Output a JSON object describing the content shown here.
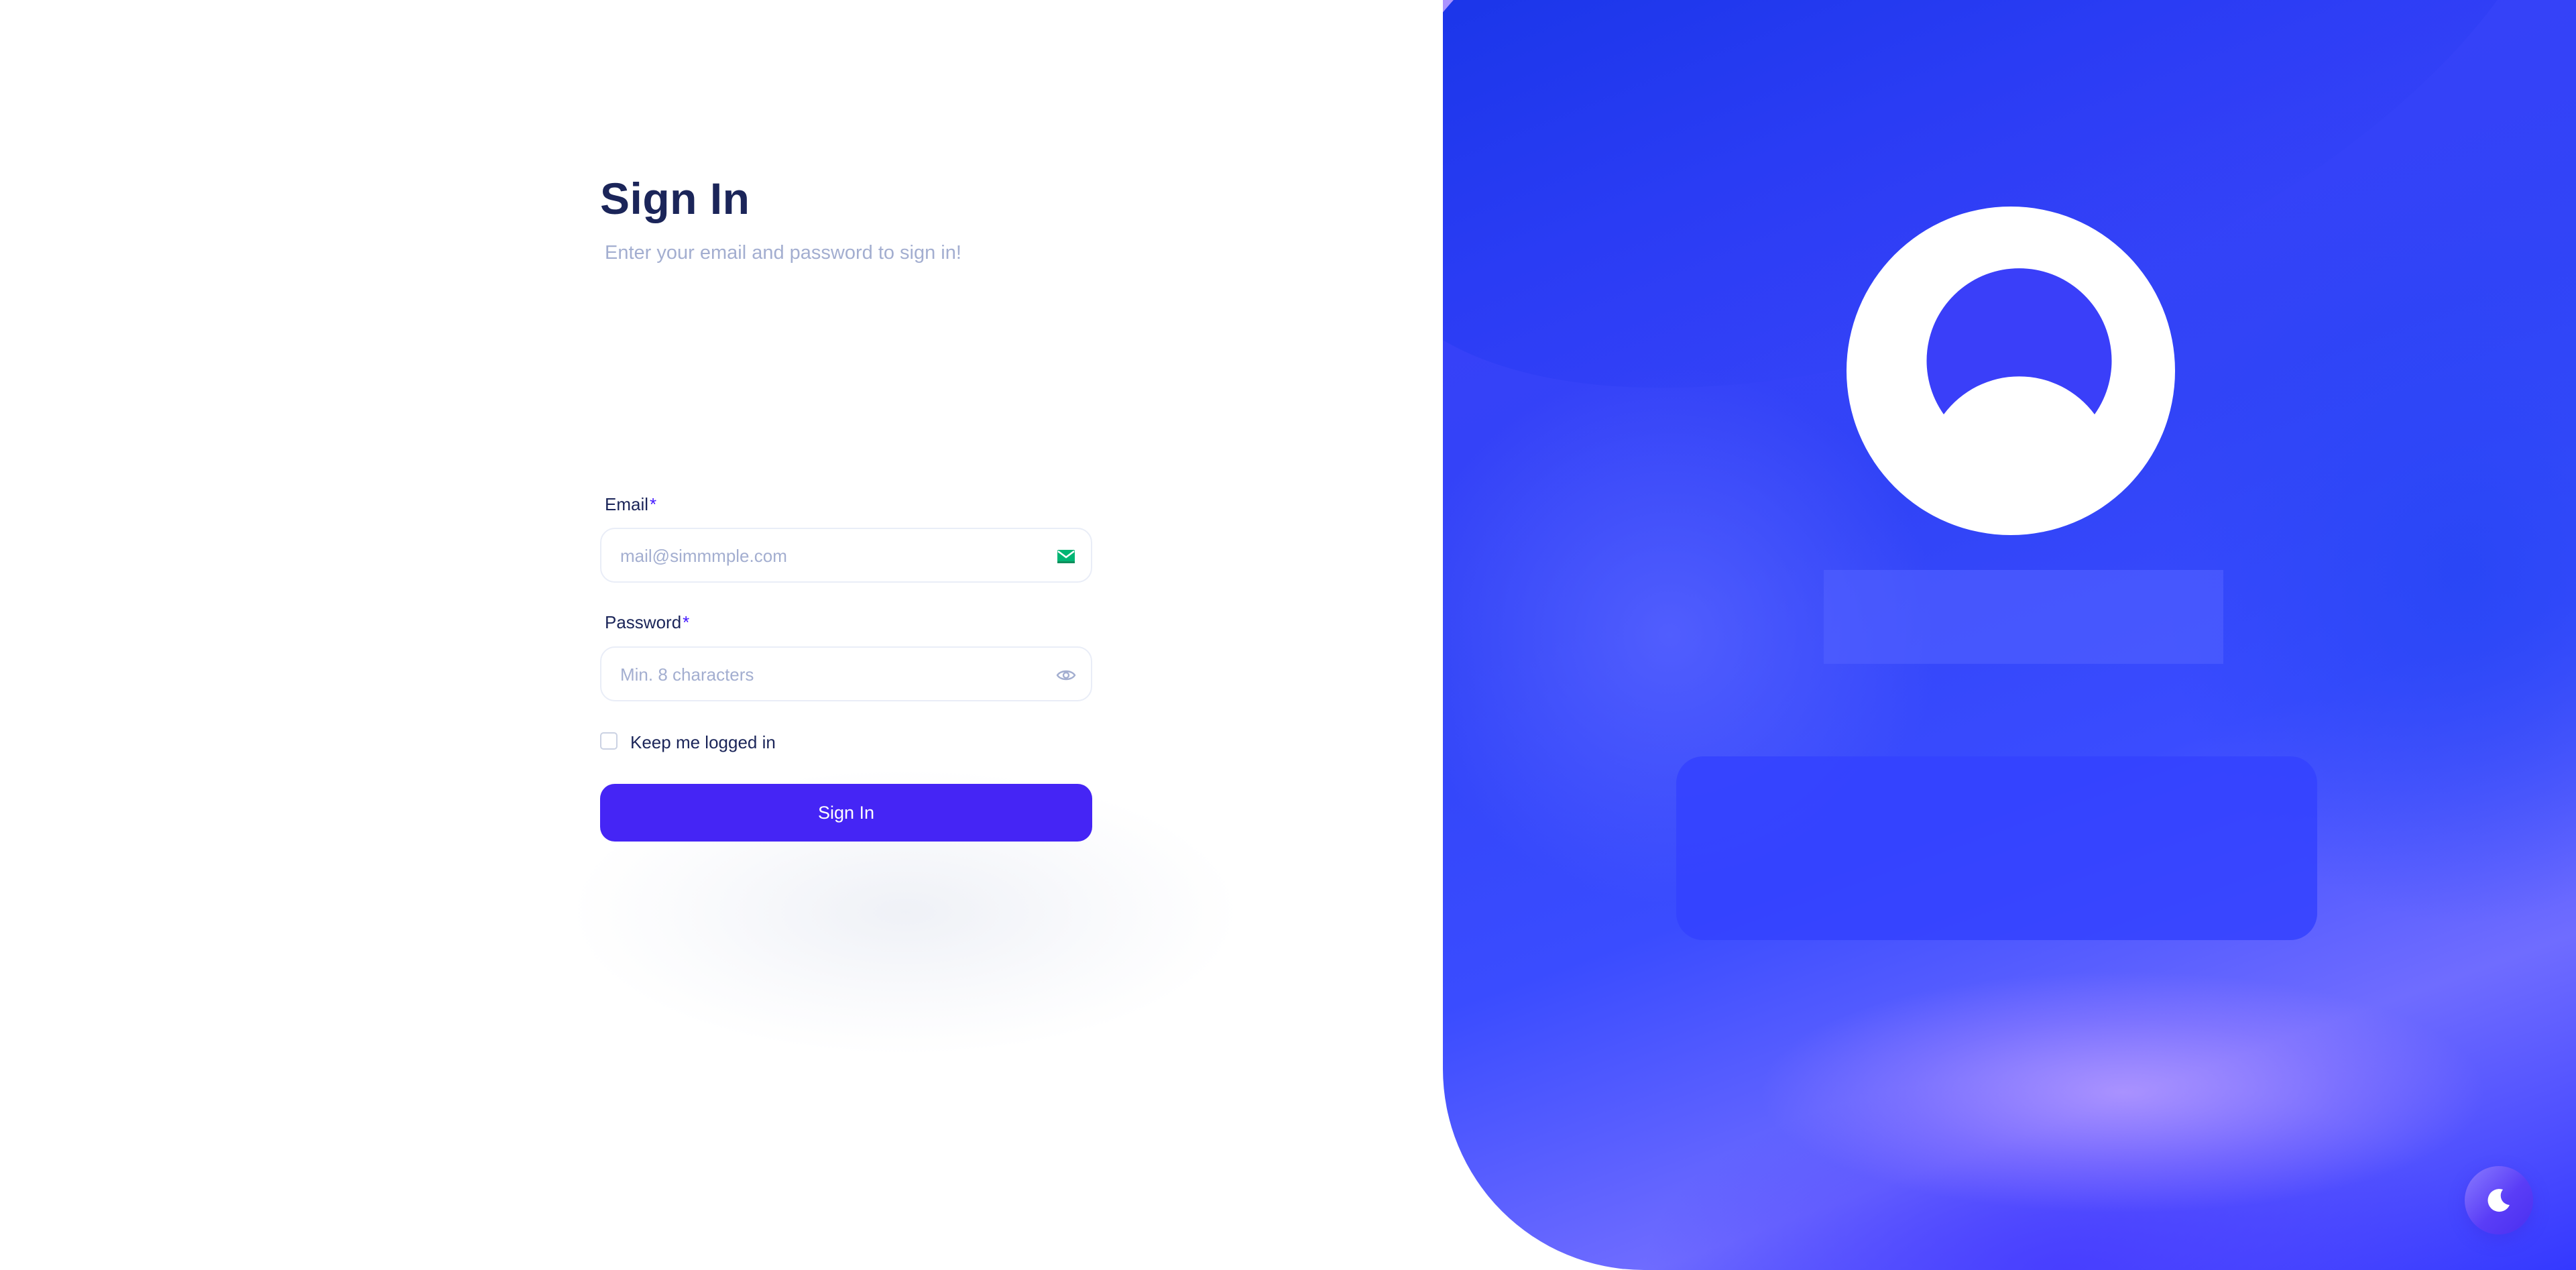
{
  "signin": {
    "title": "Sign In",
    "subtitle": "Enter your email and password to sign in!",
    "email": {
      "label": "Email",
      "required_marker": "*",
      "placeholder": "mail@simmmple.com",
      "value": "",
      "icon": "mail-icon"
    },
    "password": {
      "label": "Password",
      "required_marker": "*",
      "placeholder": "Min. 8 characters",
      "value": "",
      "icon": "eye-icon"
    },
    "keep_logged_in": {
      "label": "Keep me logged in",
      "checked": false
    },
    "submit_label": "Sign In"
  },
  "brand_panel": {
    "logo_icon": "logo-circle-icon"
  },
  "theme_toggle": {
    "icon": "moon-icon"
  },
  "colors": {
    "brand": "#4318ff",
    "button": "#4525f5",
    "heading": "#1b2559",
    "muted": "#a3aed0",
    "border": "#e9edf7",
    "mail_icon": "#01b574"
  }
}
